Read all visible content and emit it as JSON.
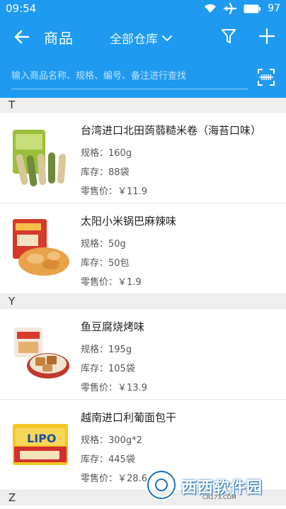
{
  "status_bar": {
    "time": "09:54",
    "battery": "97"
  },
  "header": {
    "title": "商品",
    "warehouse": "全部仓库"
  },
  "search": {
    "placeholder": "输入商品名称、规格、编号、备注进行查找"
  },
  "labels": {
    "spec": "规格：",
    "stock": "库存：",
    "price": "零售价："
  },
  "sections": [
    {
      "letter": "T",
      "items": [
        {
          "name": "台湾进口北田蒟蒻糙米卷（海苔口味）",
          "spec": "160g",
          "stock": "88袋",
          "price": "￥11.9"
        },
        {
          "name": "太阳小米锅巴麻辣味",
          "spec": "50g",
          "stock": "50包",
          "price": "￥1.9"
        }
      ]
    },
    {
      "letter": "Y",
      "items": [
        {
          "name": "鱼豆腐烧烤味",
          "spec": "195g",
          "stock": "105袋",
          "price": "￥13.9"
        },
        {
          "name": "越南进口利葡面包干",
          "spec": "300g*2",
          "stock": "445袋",
          "price": "￥28.6"
        }
      ]
    },
    {
      "letter": "Z",
      "items": []
    }
  ],
  "product_images": {
    "item_4_brand": "LIPO"
  },
  "watermark": {
    "text": "西西软件园",
    "url": "CR173.COM"
  },
  "colors": {
    "primary": "#1e9bf0",
    "section_bg": "#eeeeee"
  }
}
